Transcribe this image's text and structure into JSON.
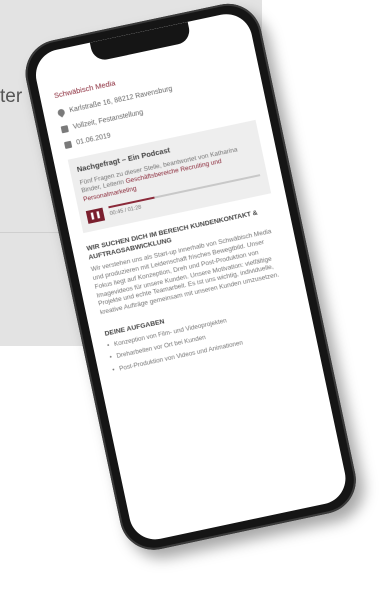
{
  "background": {
    "partial_text": "ter"
  },
  "job": {
    "company": "Schwäbisch Media",
    "address": "Karlstraße 16, 88212 Ravensburg",
    "type": "Vollzeit, Festanstellung",
    "date": "01.06.2019"
  },
  "podcast": {
    "title": "Nachgefragt – Ein Podcast",
    "desc": "Fünf Fragen zu dieser Stelle, beantwortet von Katharina Binder, Leiterin",
    "link": "Geschäftsbereiche Recruiting und Personalmarketing",
    "play_icon": "play-icon",
    "time": "00:45 / 01:28",
    "progress": 0.3
  },
  "section1": {
    "heading": "Wir suchen Dich im Bereich Kundenkontakt & Auftragsabwicklung",
    "text": "Wir verstehen uns als Start-up innerhalb von Schwäbisch Media und produzieren mit Leidenschaft frisches Bewegtbild. Unser Fokus liegt auf Konzeption, Dreh und Post-Produktion von Imagevideos für unsere Kunden. Unsere Motivation: vielfältige Projekte und echte Teamarbeit. Es ist uns wichtig, individuelle, kreative Aufträge gemeinsam mit unseren Kunden umzusetzen."
  },
  "section2": {
    "heading": "Deine Aufgaben",
    "items": [
      "Konzeption von Film- und Videoprojekten",
      "Dreharbeiten vor Ort bei Kunden",
      "Post-Produktion von Videos und Animationen"
    ]
  }
}
